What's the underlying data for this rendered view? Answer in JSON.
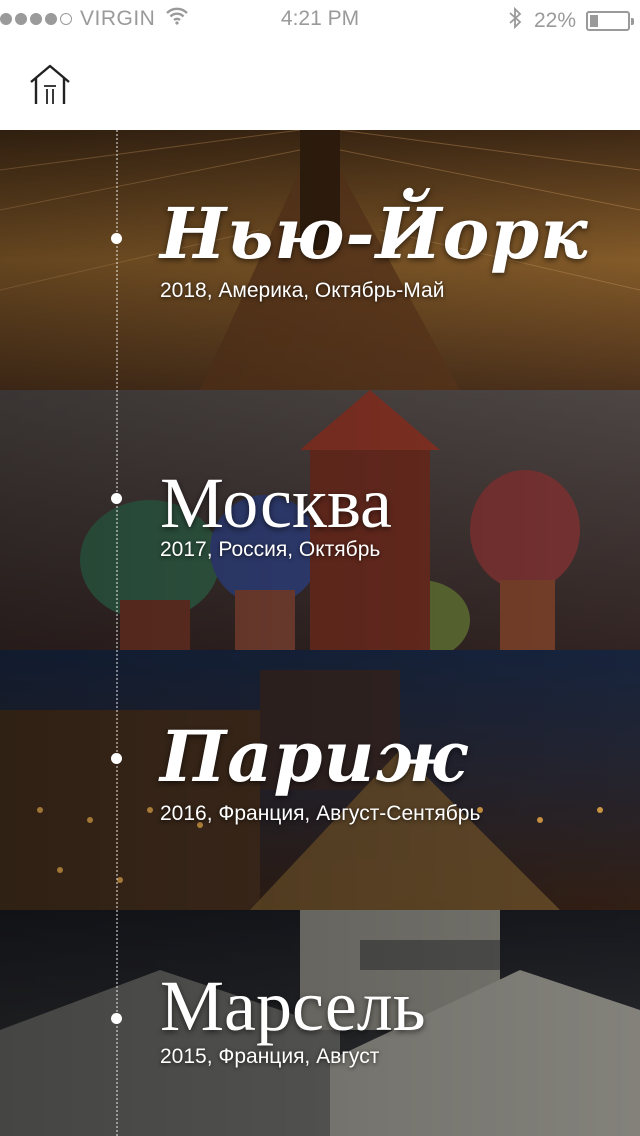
{
  "status_bar": {
    "carrier": "VIRGIN",
    "time": "4:21 PM",
    "battery_percent": "22%",
    "battery_level": 0.22,
    "signal_dots_filled": 4,
    "signal_dots_total": 5
  },
  "nav": {
    "home_icon": "home-icon"
  },
  "cities": [
    {
      "name": "Нью-Йорк",
      "details": "2018, Америка, Октябрь-Май",
      "style": "script",
      "colors": [
        "#3a2a1a",
        "#8a5a28",
        "#c8873a",
        "#5a3a20"
      ]
    },
    {
      "name": "Москва",
      "details": "2017, Россия, Октябрь",
      "style": "serif",
      "colors": [
        "#4a4444",
        "#7a6a5a",
        "#b07a50",
        "#3a2a28"
      ]
    },
    {
      "name": "Париж",
      "details": "2016, Франция, Август-Сентябрь",
      "style": "script",
      "colors": [
        "#1a2030",
        "#3a3040",
        "#8a6030",
        "#2a2020"
      ]
    },
    {
      "name": "Марсель",
      "details": "2015, Франция, Август",
      "style": "serif",
      "colors": [
        "#1a1a20",
        "#4a4a4c",
        "#8a8a86",
        "#2a2a2c"
      ]
    }
  ]
}
